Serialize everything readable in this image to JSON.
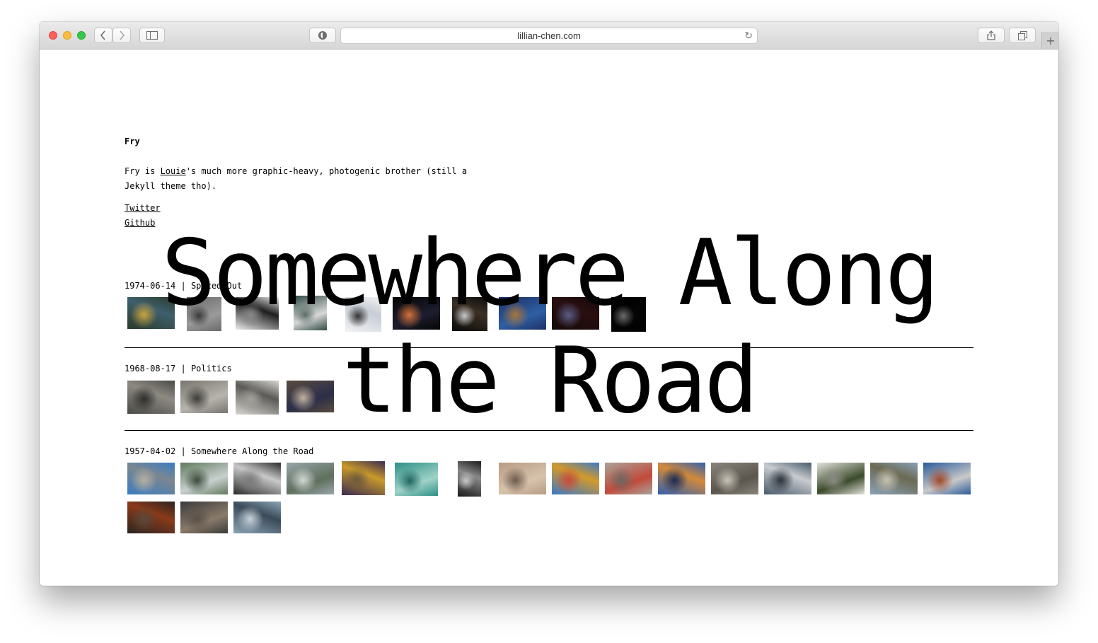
{
  "browser": {
    "url": "lillian-chen.com",
    "back_icon": "chevron-left-icon",
    "forward_icon": "chevron-right-icon",
    "new_tab_label": "+"
  },
  "site": {
    "title": "Fry",
    "desc_prefix": "Fry is ",
    "desc_link": "Louie",
    "desc_suffix": "'s much more graphic-heavy, photogenic brother (still a Jekyll theme tho).",
    "links": [
      "Twitter",
      "Github"
    ]
  },
  "hover_title": "Somewhere Along the Road",
  "entries": [
    {
      "date": "1974-06-14",
      "separator": " | ",
      "title": "Spaced Out",
      "thumbs": [
        {
          "colors": [
            "#2a3b2a",
            "#3f5f6e",
            "#c9a33c"
          ]
        },
        {
          "colors": [
            "#6b6b6b",
            "#9a9a9a",
            "#3b3b3b"
          ]
        },
        {
          "colors": [
            "#ececec",
            "#1e1e1e",
            "#8a8a8a"
          ]
        },
        {
          "colors": [
            "#2f4a44",
            "#d8d8d8",
            "#5c6f66"
          ]
        },
        {
          "colors": [
            "#f2f2f2",
            "#c7cdd6",
            "#333333"
          ]
        },
        {
          "colors": [
            "#050505",
            "#1d1d2e",
            "#d2713a"
          ]
        },
        {
          "colors": [
            "#0a0a0a",
            "#3b3024",
            "#c9c9c9"
          ]
        },
        {
          "colors": [
            "#1c2f66",
            "#2f5fa3",
            "#a9743b"
          ]
        },
        {
          "colors": [
            "#150808",
            "#2a0f10",
            "#5a5c86"
          ]
        },
        {
          "colors": [
            "#000000",
            "#050505",
            "#6a6a6a"
          ]
        }
      ]
    },
    {
      "date": "1968-08-17",
      "separator": " | ",
      "title": "Politics",
      "thumbs": [
        {
          "colors": [
            "#4a4a46",
            "#8d8a82",
            "#2e2e2a"
          ]
        },
        {
          "colors": [
            "#77756e",
            "#b7b4ad",
            "#3e3c38"
          ]
        },
        {
          "colors": [
            "#d8d6d1",
            "#5a5955",
            "#a3a19c"
          ]
        },
        {
          "colors": [
            "#5a4b3d",
            "#2b2e4a",
            "#c2b39e"
          ]
        }
      ]
    },
    {
      "date": "1957-04-02",
      "separator": " | ",
      "title": "Somewhere Along the Road",
      "thumbs": [
        {
          "colors": [
            "#3b7cc2",
            "#7a8790",
            "#b8b0a0"
          ]
        },
        {
          "colors": [
            "#5f7a5c",
            "#c9d0cf",
            "#3a4a3b"
          ]
        },
        {
          "colors": [
            "#2b2b2b",
            "#c9c9c9",
            "#7a7a7a"
          ]
        },
        {
          "colors": [
            "#97a6a8",
            "#5e6f5d",
            "#d5d8d4"
          ]
        },
        {
          "colors": [
            "#3a2a52",
            "#c99a2a",
            "#6b5a3a"
          ]
        },
        {
          "colors": [
            "#2e8f86",
            "#9fd3c8",
            "#1f6560"
          ]
        },
        {
          "colors": [
            "#1a1a1a",
            "#8a8a8a",
            "#c9c9c9"
          ]
        },
        {
          "colors": [
            "#b79b84",
            "#d7c3ad",
            "#6c5a4c"
          ]
        },
        {
          "colors": [
            "#3a78c8",
            "#d39a2a",
            "#c84a3a"
          ]
        },
        {
          "colors": [
            "#a9a39a",
            "#c24a3a",
            "#6a6660"
          ]
        },
        {
          "colors": [
            "#2f5fb0",
            "#d48a3a",
            "#1a2a50"
          ]
        },
        {
          "colors": [
            "#8a857c",
            "#5a554d",
            "#c9c3b8"
          ]
        },
        {
          "colors": [
            "#4a5a6a",
            "#c9ccd0",
            "#2a3038"
          ]
        },
        {
          "colors": [
            "#e2e2dc",
            "#3a4a2a",
            "#8a8a80"
          ]
        },
        {
          "colors": [
            "#8aa0b8",
            "#6b6a52",
            "#c7c2b0"
          ]
        },
        {
          "colors": [
            "#2a5a9a",
            "#c9c9c9",
            "#a04a2a"
          ]
        },
        {
          "colors": [
            "#2a2420",
            "#8a3a1a",
            "#5a4a3a"
          ]
        },
        {
          "colors": [
            "#3a3a3a",
            "#8a7a6a",
            "#5a5048"
          ]
        },
        {
          "colors": [
            "#8aa4b4",
            "#3a4a5a",
            "#c9d4dc"
          ]
        }
      ]
    }
  ]
}
